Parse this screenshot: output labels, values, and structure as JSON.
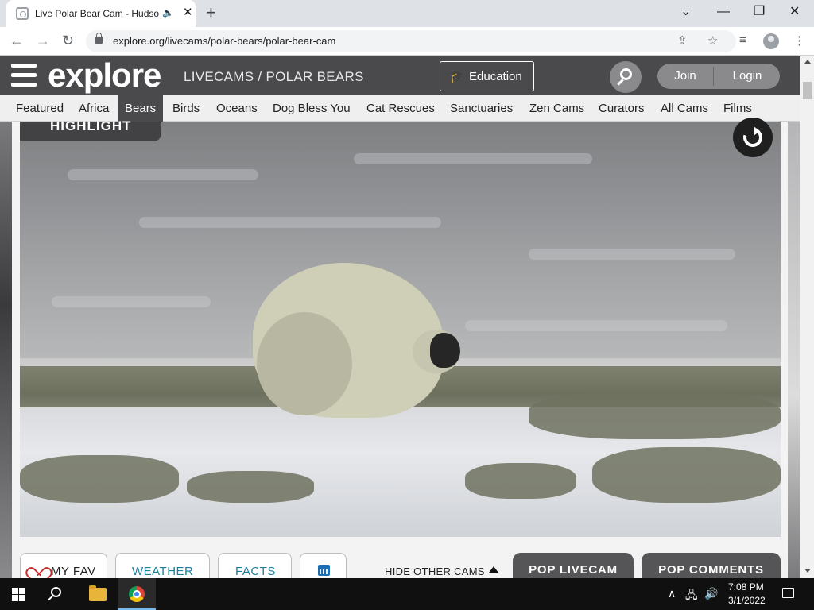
{
  "browser": {
    "tab_title": "Live Polar Bear Cam - Hudson",
    "url": "explore.org/livecams/polar-bears/polar-bear-cam",
    "new_tab": "+",
    "back": "←",
    "forward": "→",
    "reload": "↻",
    "share": "⇪",
    "bookmark": "☆",
    "reading_list": "≡",
    "menu": "⋮",
    "minimize": "—",
    "restore": "❐",
    "close": "✕",
    "tabs_dropdown": "⌄",
    "audio": "🔈"
  },
  "header": {
    "logo": "explore",
    "breadcrumb": "LIVECAMS / POLAR BEARS",
    "education": "Education",
    "education_icon": "🎓",
    "join": "Join",
    "login": "Login"
  },
  "categories": [
    "Featured",
    "Africa",
    "Bears",
    "Birds",
    "Oceans",
    "Dog Bless You",
    "Cat Rescues",
    "Sanctuaries",
    "Zen Cams",
    "Curators",
    "All Cams",
    "Films"
  ],
  "active_category": "Bears",
  "player": {
    "badge": "HIGHLIGHT"
  },
  "controls": {
    "my_fav": "MY FAV",
    "weather": "WEATHER",
    "facts": "FACTS",
    "hide_other_cams": "HIDE OTHER CAMS",
    "pop_livecam": "POP LIVECAM",
    "pop_comments": "POP COMMENTS"
  },
  "taskbar": {
    "time": "7:08 PM",
    "date": "3/1/2022",
    "tray_chevron": "∧",
    "tray_network": "🖧",
    "tray_volume": "🔊"
  },
  "colors": {
    "header_bg": "#4a4a4c",
    "accent_teal": "#1a7f9a",
    "heart": "#cc2b2b",
    "pop_btn": "#555557"
  }
}
